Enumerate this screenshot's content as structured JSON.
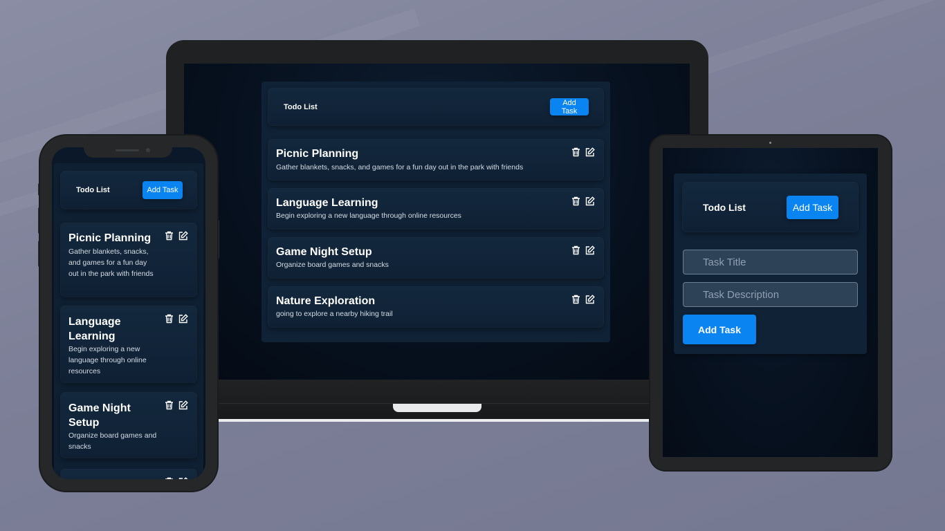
{
  "app": {
    "title": "Todo List",
    "add_task_label": "Add Task"
  },
  "tasks": [
    {
      "title": "Picnic Planning",
      "description": "Gather blankets, snacks, and games for a fun day out in the park with friends"
    },
    {
      "title": "Language Learning",
      "description": "Begin exploring a new language through online resources"
    },
    {
      "title": "Game Night Setup",
      "description": "Organize board games and snacks"
    },
    {
      "title": "Nature Exploration",
      "description": "going to explore a nearby hiking trail"
    }
  ],
  "form": {
    "title_placeholder": "Task Title",
    "description_placeholder": "Task Description",
    "submit_label": "Add Task"
  },
  "icons": {
    "delete": "trash-icon",
    "edit": "edit-icon"
  },
  "colors": {
    "accent": "#0a84f0",
    "card": "#13283d",
    "screen": "#07111f"
  }
}
